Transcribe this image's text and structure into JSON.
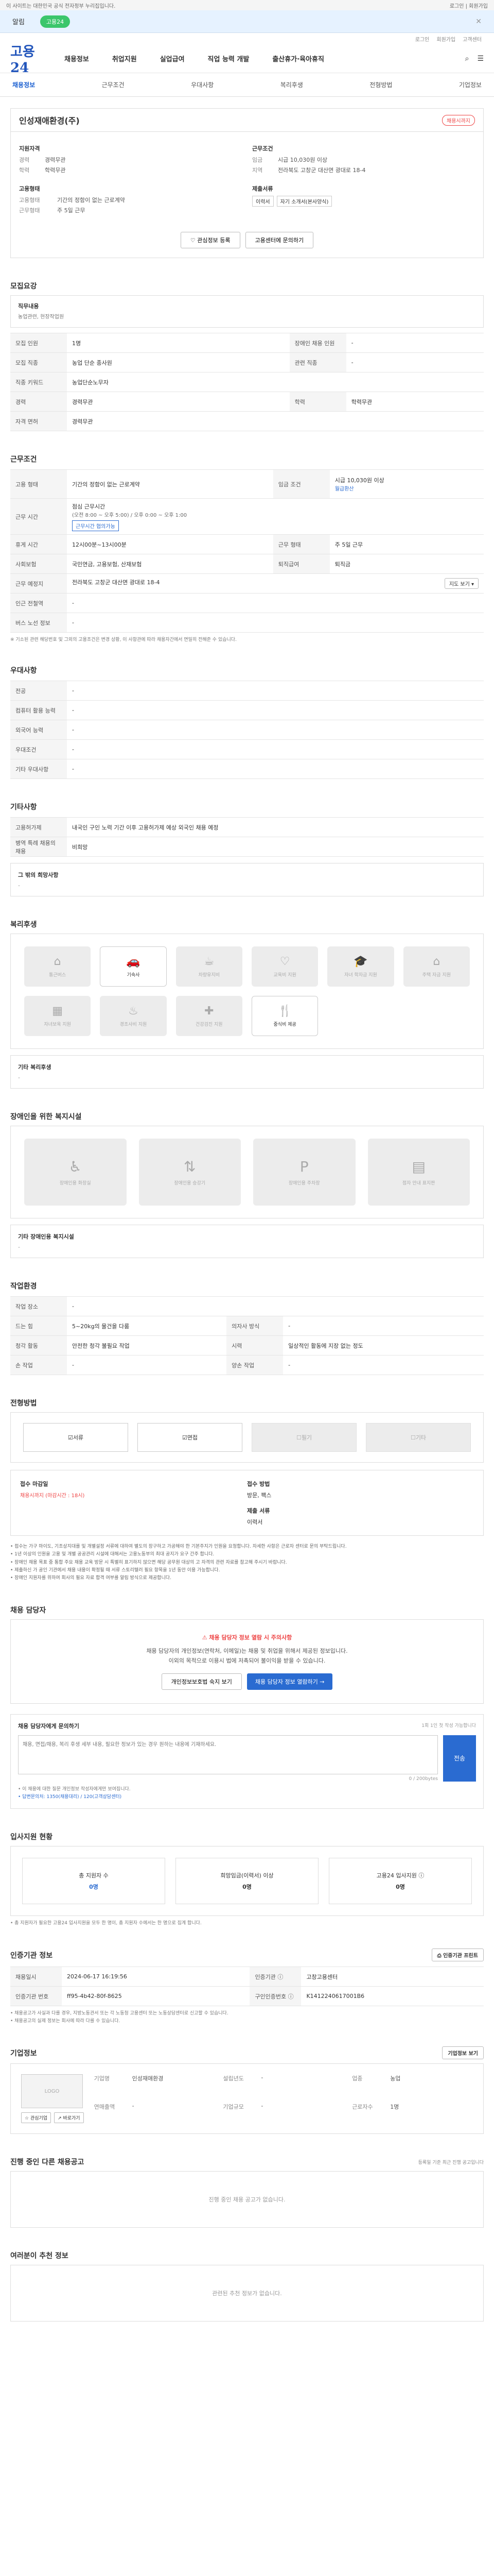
{
  "topbar": {
    "left": "이 사이트는 대한민국 공식 전자정부 누리집입니다.",
    "right": "로그인 | 회원가입"
  },
  "banner": {
    "label": "알림",
    "pill": "고용24",
    "close": "✕"
  },
  "util": [
    "로그인",
    "회원가입",
    "고객센터"
  ],
  "gnb": {
    "logo": "고용24",
    "menus": [
      "채용정보",
      "취업지원",
      "실업급여",
      "직업 능력 개발",
      "출산휴가·육아휴직"
    ]
  },
  "subnav": [
    "채용정보",
    "근무조건",
    "우대사항",
    "복리후생",
    "전형방법",
    "기업정보"
  ],
  "header": {
    "company": "인성재애환경(주)",
    "badge": "채용시까지",
    "left_group": "지원자격",
    "left_items": [
      {
        "k": "경력",
        "v": "경력무관"
      },
      {
        "k": "학력",
        "v": "학력무관"
      }
    ],
    "left_group2": "고용형태",
    "left_items2": [
      {
        "k": "고용형태",
        "v": "기간의 정함이 없는 근로계약"
      },
      {
        "k": "근무형태",
        "v": "주 5일 근무"
      }
    ],
    "right_group": "근무조건",
    "right_items": [
      {
        "k": "임금",
        "v": "시급 10,030원 이상"
      },
      {
        "k": "지역",
        "v": "전라북도 고창군 대산면 광대로 18-4"
      }
    ],
    "right_group2": "제출서류",
    "stamp": "이력서",
    "stamp2": "자기 소개서(본사양식)",
    "btn_fav": "관심정보 등록",
    "btn_help": "고용센터에 문의하기"
  },
  "recruit": {
    "title": "모집요강",
    "box_title": "직무내용",
    "box_sub": "농업관련, 현장작업원",
    "rows": [
      {
        "k": "모집 인원",
        "v": "1명",
        "k2": "장애인 채용 인원",
        "v2": "-"
      },
      {
        "k": "모집 직종",
        "v": "농업 단순 종사원",
        "k2": "관련 직종",
        "v2": "-"
      },
      {
        "k": "직종 키워드",
        "v": "농업단순노무자"
      },
      {
        "k": "경력",
        "v": "경력무관",
        "k2": "학력",
        "v2": "학력무관"
      },
      {
        "k": "자격 면허",
        "v": "경력무관"
      }
    ]
  },
  "conditions": {
    "title": "근무조건",
    "rows": [
      {
        "k": "고용 형태",
        "v": "기간의 정함이 없는 근로계약",
        "k2": "임금 조건",
        "v2": "시급 10,030원 이상",
        "v2b": "월급환산"
      },
      {
        "k": "근무 시간",
        "v": "점심 근무시간",
        "vb": "(오전 8:00 ~ 오후 5:00) / 오후 0:00 ~ 오후 1:00",
        "vc": "근무시간 협의가능"
      },
      {
        "k": "휴게 시간",
        "v": "12시00분~13시00분",
        "k2": "근무 형태",
        "v2": "주 5일 근무"
      },
      {
        "k": "사회보험",
        "v": "국민연금, 고용보험, 산재보험",
        "k2": "퇴직급여",
        "v2": "퇴직금"
      },
      {
        "k": "근무 예정지",
        "v": "전라북도 고창군 대산면 광대로 18-4",
        "btn": "지도 보기 ▾"
      },
      {
        "k": "인근 전철역",
        "v": "-"
      },
      {
        "k": "버스 노선 정보",
        "v": "-"
      }
    ],
    "note": "※ 기소된 관련 해당번호 및 그외의 고용조건은 변경 상황, 이 사항관에 따라 채용자간에서 면밀히 전해준 수 있습니다."
  },
  "prefer": {
    "title": "우대사항",
    "rows": [
      {
        "k": "전공",
        "v": "-"
      },
      {
        "k": "컴퓨터 활용 능력",
        "v": "-"
      },
      {
        "k": "외국어 능력",
        "v": "-"
      },
      {
        "k": "우대조건",
        "v": "-"
      },
      {
        "k": "기타 우대사항",
        "v": "-"
      }
    ]
  },
  "etc": {
    "title": "기타사항",
    "rows": [
      {
        "k": "고용허가제",
        "v": "내국인 구인 노력 기간 이후 고용허가제 예상 외국인 채용 예정"
      },
      {
        "k": "병역 특례 채용의 채용",
        "v": "비희망"
      }
    ],
    "sub_title": "그 밖의 희망사항",
    "sub_dash": "-"
  },
  "welfare": {
    "title": "복리후생",
    "tiles": [
      {
        "icon": "⌂",
        "label": "통근버스",
        "on": false
      },
      {
        "icon": "🚗",
        "label": "기숙사",
        "on": true
      },
      {
        "icon": "☕",
        "label": "차량유지비",
        "on": false
      },
      {
        "icon": "♡",
        "label": "교육비 지원",
        "on": false
      },
      {
        "icon": "🎓",
        "label": "자녀 학자금 지원",
        "on": false
      },
      {
        "icon": "⌂",
        "label": "주택 자금 지원",
        "on": false
      },
      {
        "icon": "▦",
        "label": "자녀보육 지원",
        "on": false
      },
      {
        "icon": "♨",
        "label": "경조사비 지원",
        "on": false
      },
      {
        "icon": "✚",
        "label": "건강검진 지원",
        "on": false
      },
      {
        "icon": "🍴",
        "label": "중식비 제공",
        "on": true
      }
    ],
    "sub_title": "기타 복리후생",
    "sub_dash": "-"
  },
  "disabled": {
    "title": "장애인을 위한 복지시설",
    "tiles": [
      {
        "icon": "♿",
        "label": "장애인용 화장실"
      },
      {
        "icon": "⇅",
        "label": "장애인용 승강기"
      },
      {
        "icon": "P",
        "label": "장애인용 주차장"
      },
      {
        "icon": "▤",
        "label": "점자 안내 표지판"
      }
    ],
    "sub_title": "기타 장애인용 복지시설",
    "sub_dash": "-"
  },
  "env": {
    "title": "작업환경",
    "rows": [
      {
        "k": "작업 장소",
        "v": "-"
      },
      {
        "k": "드는 힘",
        "v": "5~20kg의 물건을 다룸",
        "k2": "의자사 방식",
        "v2": "-"
      },
      {
        "k": "청각 활동",
        "v": "안전한 청각 불필요 작업",
        "k2": "시력",
        "v2": "일상적인 활동에 지장 없는 정도"
      },
      {
        "k": "손 작업",
        "v": "-",
        "k2": "양손 작업",
        "v2": "-"
      }
    ]
  },
  "process": {
    "title": "전형방법",
    "steps": [
      {
        "label": "서류",
        "on": true
      },
      {
        "label": "면접",
        "on": true
      },
      {
        "label": "필기",
        "on": false
      },
      {
        "label": "기타",
        "on": false
      }
    ],
    "info": {
      "deadline_label": "접수 마감일",
      "deadline_value": "채용시까지 (마감시간 : 18시)",
      "method_label": "접수 방법",
      "method_value": "방문, 팩스",
      "docs_label": "제출 서류",
      "docs_value": "이력서"
    },
    "notes": [
      "• 접수는 가구 마이도, 기조상지대를 및 개별설정 서류에 대하여 별도의 장구하고 가공해야 한 기본주지가 인원을 요청합니다. 자세한 사항은 근로자 센터로 문의 부탁드립니다.",
      "• 1년 이상의 인원을 고용 및 개별 공공관리 시설에 대해서는 고용노동부의 최대 공지가 요구 간주 합니다.",
      "• 장애인 채용 목표 중 통합 주요 채용 교육 방문 시 특별히 표기하지 않으면 해당 공무원 대상의 고 자격의 관련 자료를 참고해 주시기 바랍니다.",
      "• 제출하신 가 공인 기관에서 채용 내용이 확정될 때 서류 스토리텔러 필요 항목을 1년 동안 이용 가능합니다.",
      "• 장애인 지원자를 위하여 회사의 필요 자료 합격 여부를 알림 방식으로 제공합니다."
    ]
  },
  "contact": {
    "title": "채용 담당자",
    "warn_title": "⚠ 채용 담당자 정보 열람 시 주의사항",
    "warn_lines": [
      "채용 담당자의 개인정보(연락처, 이메일)는 채용 및 취업을 위해서 제공된 정보입니다.",
      "이외의 목적으로 이용시 법에 저촉되어 불이익을 받을 수 있습니다."
    ],
    "btn_consent": "개인정보보호법 숙지 보기",
    "btn_view": "채용 담당자 정보 열람하기 →",
    "inq_title": "채용 담당자에게 문의하기",
    "inq_right": "1회 1인 첫 작성 가능합니다",
    "inq_placeholder": "채용, 면접/채용, 복리 후생 세부 내용, 필요한 정보가 있는 경우 원하는 내용에 기재하세요.",
    "inq_count": "0 / 200bytes",
    "inq_send": "전송",
    "inq_notes": [
      "• 이 채용에 대한 질문 개인정보 작성자에게만 보여집니다.",
      "• 답변문의처: 1350(채용대리) / 120(고객상담센터)"
    ]
  },
  "stats": {
    "title": "입사지원 현황",
    "items": [
      {
        "label": "총 지원자 수",
        "value": "0명",
        "blue": true
      },
      {
        "label": "희망임금(이력서) 이상",
        "value": "0명",
        "blue": false
      },
      {
        "label": "고용24 입사지원 ⓘ",
        "value": "0명",
        "blue": false
      }
    ],
    "note": "• 총 지원자가 필요한 고용24 입사지원을 모두 한 명이, 총 지원자 수에서는 한 명으로 집계 합니다."
  },
  "inst": {
    "title": "인증기관 정보",
    "btn": "인증기관 프린트",
    "rows": [
      {
        "k": "채용일시",
        "v": "2024-06-17 16:19:56",
        "k2": "인증기관 ⓘ",
        "v2": "고창고용센터"
      },
      {
        "k": "인증기관 번호",
        "v": "ff95-4b42-80f-8625",
        "k2": "구인인증번호 ⓘ",
        "v2": "K1412240617001B6"
      }
    ],
    "notes": [
      "• 채용공고가 사실과 다를 경우, 지방노동관서 또는 각 노동청 고용센터 또는 노동상담센터로 신고할 수 있습니다.",
      "• 채용공고의 실제 정보는 회사에 따라 다를 수 있습니다."
    ]
  },
  "company": {
    "title": "기업정보",
    "btn_cinfo": "기업정보 보기",
    "logo": "LOGO",
    "btn_a": "관심기업",
    "btn_b": "바로가기",
    "fields": [
      {
        "k": "기업명",
        "v": "인성재애환경"
      },
      {
        "k": "설립년도",
        "v": "-"
      },
      {
        "k": "업종",
        "v": "농업"
      },
      {
        "k": "연매출액",
        "v": "-"
      },
      {
        "k": "기업규모",
        "v": "-"
      },
      {
        "k": "근로자수",
        "v": "1명"
      }
    ]
  },
  "other": {
    "title": "진행 중인 다른 채용공고",
    "right": "등록일 기준 최근 진행 공고입니다",
    "empty": "진행 중인 채용 공고가 없습니다."
  },
  "recommend": {
    "title": "여러분이 추천 정보",
    "empty": "관련된 추천 정보가 없습니다."
  }
}
